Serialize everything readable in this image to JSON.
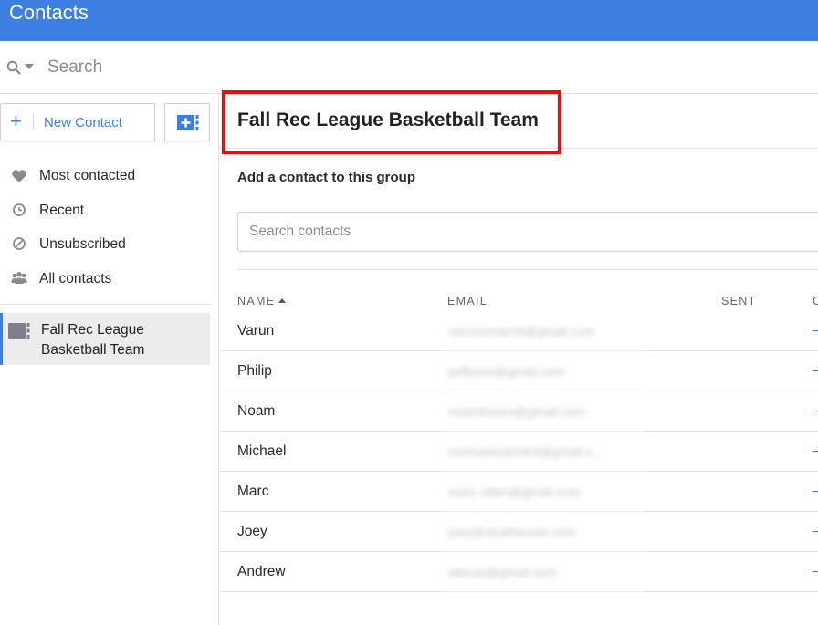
{
  "app": {
    "title": "Contacts"
  },
  "search": {
    "placeholder": "Search"
  },
  "sidebar": {
    "new_contact_label": "New Contact",
    "nav": [
      {
        "label": "Most contacted",
        "icon": "heart-icon"
      },
      {
        "label": "Recent",
        "icon": "clock-icon"
      },
      {
        "label": "Unsubscribed",
        "icon": "block-icon"
      },
      {
        "label": "All contacts",
        "icon": "people-icon"
      }
    ],
    "group": {
      "label": "Fall Rec League Basketball Team",
      "icon": "group-icon"
    }
  },
  "main": {
    "group_title": "Fall Rec League Basketball Team",
    "add_label": "Add a contact to this group",
    "contact_search_placeholder": "Search contacts",
    "columns": {
      "name": "NAME",
      "email": "EMAIL",
      "sent": "SENT",
      "extra": "C"
    },
    "rows": [
      {
        "name": "Varun",
        "email": "varunomarn9@gmail.com"
      },
      {
        "name": "Philip",
        "email": "p4lbonn@gmail.com"
      },
      {
        "name": "Noam",
        "email": "noamhaves@gmail.com"
      },
      {
        "name": "Michael",
        "email": "michaelwalsh63@gmail.c..."
      },
      {
        "name": "Marc",
        "email": "marc.sillen@gmail.com"
      },
      {
        "name": "Joey",
        "email": "joey@strathanser.com"
      },
      {
        "name": "Andrew",
        "email": "aleuve@gmail.com"
      }
    ]
  },
  "colors": {
    "accent": "#3d7fe0",
    "highlight": "#e31010"
  }
}
